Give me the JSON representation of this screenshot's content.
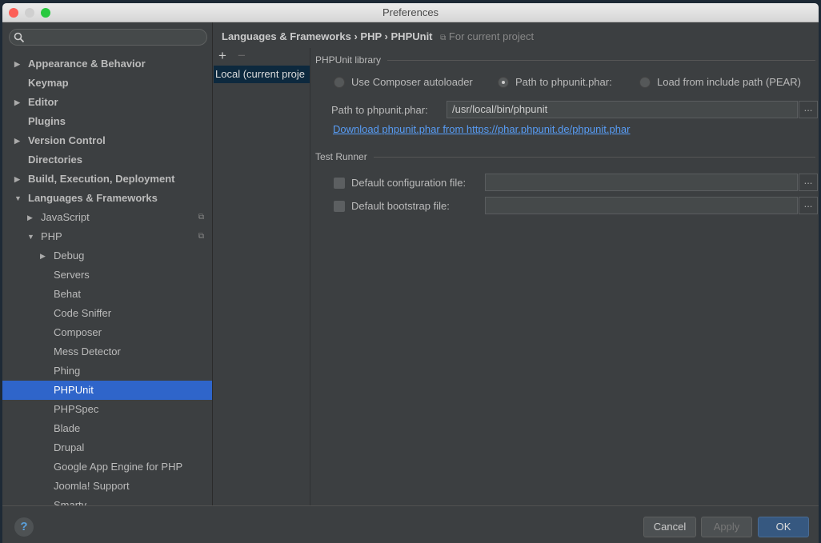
{
  "window": {
    "title": "Preferences"
  },
  "sidebar": {
    "items": [
      {
        "label": "Appearance & Behavior",
        "level": 0,
        "bold": true,
        "arrow": "right"
      },
      {
        "label": "Keymap",
        "level": 0,
        "bold": true,
        "arrow": ""
      },
      {
        "label": "Editor",
        "level": 0,
        "bold": true,
        "arrow": "right"
      },
      {
        "label": "Plugins",
        "level": 0,
        "bold": true,
        "arrow": ""
      },
      {
        "label": "Version Control",
        "level": 0,
        "bold": true,
        "arrow": "right"
      },
      {
        "label": "Directories",
        "level": 0,
        "bold": true,
        "arrow": ""
      },
      {
        "label": "Build, Execution, Deployment",
        "level": 0,
        "bold": true,
        "arrow": "right"
      },
      {
        "label": "Languages & Frameworks",
        "level": 0,
        "bold": true,
        "arrow": "down"
      },
      {
        "label": "JavaScript",
        "level": 1,
        "arrow": "right",
        "copy": true
      },
      {
        "label": "PHP",
        "level": 1,
        "arrow": "down",
        "copy": true
      },
      {
        "label": "Debug",
        "level": 2,
        "arrow": "right"
      },
      {
        "label": "Servers",
        "level": 2
      },
      {
        "label": "Behat",
        "level": 2
      },
      {
        "label": "Code Sniffer",
        "level": 2
      },
      {
        "label": "Composer",
        "level": 2
      },
      {
        "label": "Mess Detector",
        "level": 2
      },
      {
        "label": "Phing",
        "level": 2
      },
      {
        "label": "PHPUnit",
        "level": 2,
        "selected": true
      },
      {
        "label": "PHPSpec",
        "level": 2
      },
      {
        "label": "Blade",
        "level": 2
      },
      {
        "label": "Drupal",
        "level": 2
      },
      {
        "label": "Google App Engine for PHP",
        "level": 2
      },
      {
        "label": "Joomla! Support",
        "level": 2
      },
      {
        "label": "Smarty",
        "level": 2
      }
    ]
  },
  "breadcrumb": {
    "items": [
      "Languages & Frameworks",
      "PHP",
      "PHPUnit"
    ],
    "sep": "›",
    "project_note": "For current project"
  },
  "interpreters": {
    "add": "+",
    "remove": "−",
    "items": [
      "Local (current proje"
    ]
  },
  "library": {
    "title": "PHPUnit library",
    "options": [
      "Use Composer autoloader",
      "Path to phpunit.phar:",
      "Load from include path (PEAR)"
    ],
    "selected": 1,
    "path_label": "Path to phpunit.phar:",
    "path_value": "/usr/local/bin/phpunit",
    "download_link": "Download phpunit.phar from https://phar.phpunit.de/phpunit.phar",
    "browse": "..."
  },
  "runner": {
    "title": "Test Runner",
    "config_label": "Default configuration file:",
    "config_value": "",
    "bootstrap_label": "Default bootstrap file:",
    "bootstrap_value": "",
    "browse": "..."
  },
  "footer": {
    "help": "?",
    "cancel": "Cancel",
    "apply": "Apply",
    "ok": "OK"
  }
}
